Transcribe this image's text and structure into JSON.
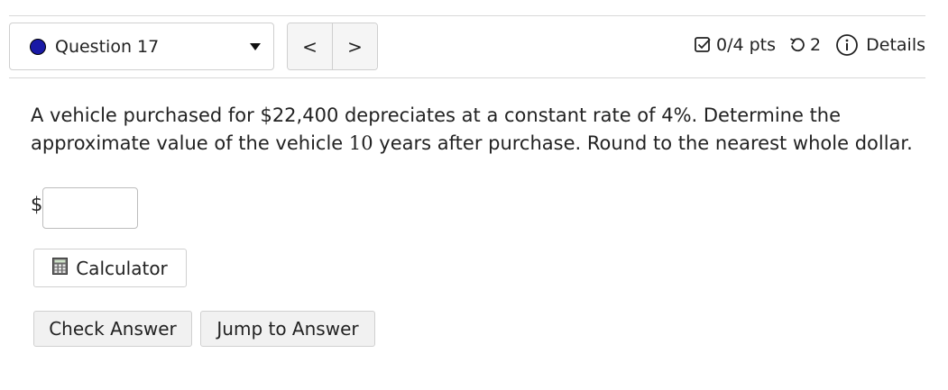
{
  "header": {
    "question_label": "Question 17",
    "prev_symbol": "<",
    "next_symbol": ">",
    "points": "0/4 pts",
    "retries": "2",
    "details_label": "Details"
  },
  "question": {
    "text_before": "A vehicle purchased for $22,400 depreciates at a constant rate of 4%. Determine the approximate value of the vehicle ",
    "years": "10",
    "text_after": " years after purchase. Round to the nearest whole dollar."
  },
  "answer": {
    "prefix": "$",
    "value": ""
  },
  "buttons": {
    "calculator": "Calculator",
    "check_answer": "Check Answer",
    "jump_to_answer": "Jump to Answer"
  },
  "colors": {
    "question_dot": "#1a1aa6",
    "rule": "#d8d8d8"
  },
  "icons": [
    "caret-down-icon",
    "checkbox-icon",
    "retry-icon",
    "info-icon",
    "calculator-icon"
  ]
}
